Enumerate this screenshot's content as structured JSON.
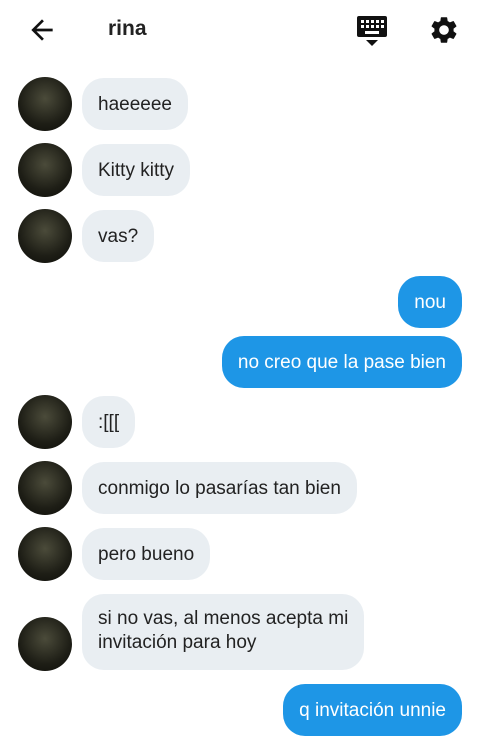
{
  "header": {
    "title": "rina",
    "back_icon": "arrow-left-icon",
    "keyboard_icon": "keyboard-icon",
    "settings_icon": "gear-icon"
  },
  "colors": {
    "incoming_bubble": "#e9eef2",
    "outgoing_bubble": "#1e96e6"
  },
  "messages": [
    {
      "from": "them",
      "text": "haeeeee"
    },
    {
      "from": "them",
      "text": "Kitty kitty"
    },
    {
      "from": "them",
      "text": "vas?"
    },
    {
      "from": "me",
      "text": "nou"
    },
    {
      "from": "me",
      "text": "no creo que la pase bien"
    },
    {
      "from": "them",
      "text": ":[[["
    },
    {
      "from": "them",
      "text": "conmigo lo pasarías tan bien"
    },
    {
      "from": "them",
      "text": "pero bueno"
    },
    {
      "from": "them",
      "text": "si no vas, al menos  acepta mi\ninvitación para hoy"
    },
    {
      "from": "me",
      "text": "q invitación unnie"
    }
  ]
}
